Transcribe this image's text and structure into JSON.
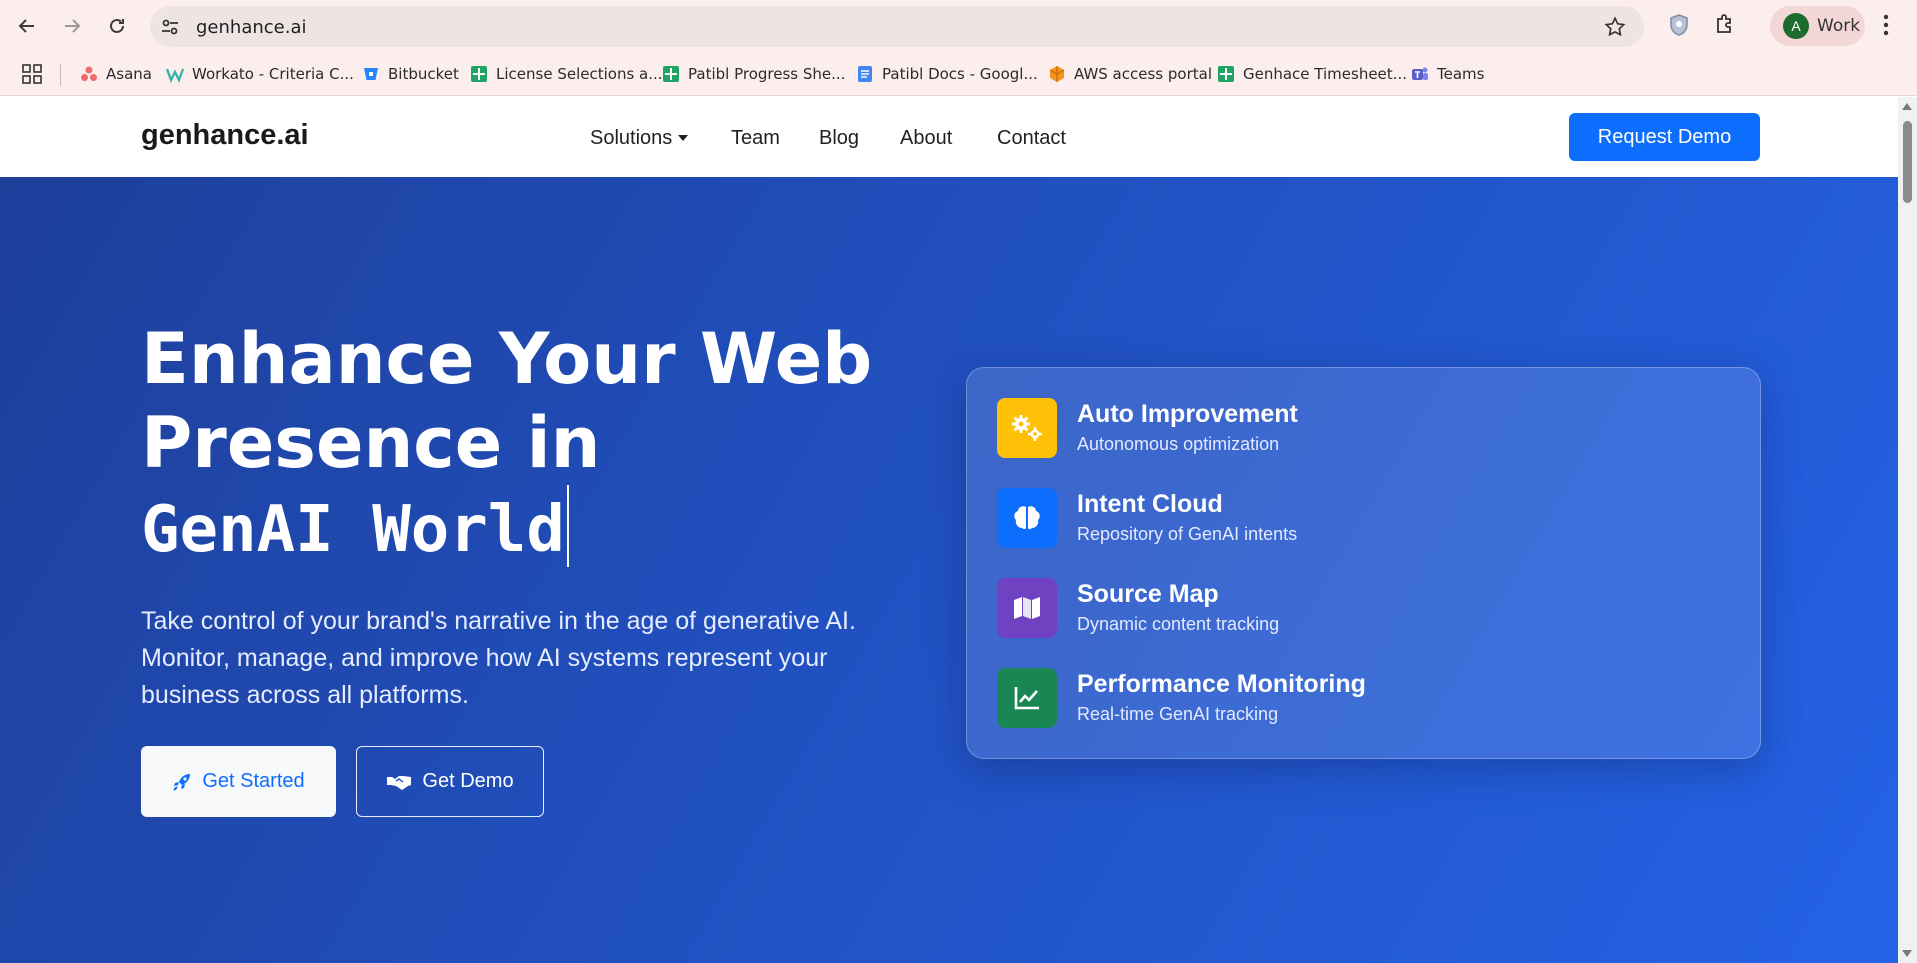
{
  "browser": {
    "url": "genhance.ai",
    "profile_initial": "A",
    "profile_name": "Work"
  },
  "bookmarks": [
    {
      "label": "Asana",
      "icon": "asana-icon"
    },
    {
      "label": "Workato - Criteria C...",
      "icon": "workato-icon"
    },
    {
      "label": "Bitbucket",
      "icon": "bitbucket-icon"
    },
    {
      "label": "License Selections a...",
      "icon": "sheets-icon"
    },
    {
      "label": "Patibl Progress She...",
      "icon": "sheets-icon"
    },
    {
      "label": "Patibl Docs - Googl...",
      "icon": "docs-icon"
    },
    {
      "label": "AWS access portal",
      "icon": "aws-icon"
    },
    {
      "label": "Genhace Timesheet...",
      "icon": "sheets-icon"
    },
    {
      "label": "Teams",
      "icon": "teams-icon"
    }
  ],
  "nav": {
    "logo": "genhance.ai",
    "items": [
      "Solutions",
      "Team",
      "Blog",
      "About",
      "Contact"
    ],
    "cta": "Request Demo"
  },
  "hero": {
    "title_line1": "Enhance Your Web",
    "title_line2": "Presence in",
    "title_typed": "GenAI World",
    "subtitle": "Take control of your brand's narrative in the age of generative AI. Monitor, manage, and improve how AI systems represent your business across all platforms.",
    "btn_primary": "Get Started",
    "btn_secondary": "Get Demo"
  },
  "features": [
    {
      "title": "Auto Improvement",
      "desc": "Autonomous optimization",
      "icon": "gears-icon",
      "color": "#ffc107"
    },
    {
      "title": "Intent Cloud",
      "desc": "Repository of GenAI intents",
      "icon": "brain-icon",
      "color": "#0d6efd"
    },
    {
      "title": "Source Map",
      "desc": "Dynamic content tracking",
      "icon": "map-icon",
      "color": "#6f42c1"
    },
    {
      "title": "Performance Monitoring",
      "desc": "Real-time GenAI tracking",
      "icon": "chart-line-icon",
      "color": "#198754"
    }
  ],
  "colors": {
    "primary": "#0d6efd",
    "hero_start": "#1e3f9a",
    "hero_end": "#2563e6"
  }
}
